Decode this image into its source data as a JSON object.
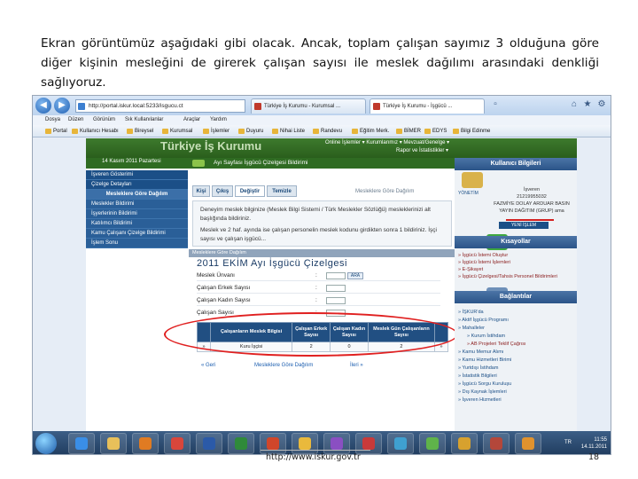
{
  "slide": {
    "intro_text": "Ekran görüntümüz aşağıdaki gibi olacak. Ancak, toplam çalışan sayımız 3 olduğuna göre diğer kişinin mesleğini de girerek çalışan sayısı ile meslek dağılımı arasındaki denkliği sağlıyoruz.",
    "footer_url": "http://www.iskur.gov.tr",
    "page_number": "18"
  },
  "browser": {
    "address": "http://portal.iskur.local:5233/isgucu.ct",
    "tabs": [
      "Türkiye İş Kurumu - Kurumsal ...",
      "Türkiye İş Kurumu - İşgücü ..."
    ],
    "menu": [
      "Dosya",
      "Düzen",
      "Görünüm",
      "Sık Kullanılanlar",
      "Araçlar",
      "Yardım"
    ],
    "favorites": [
      "Portal",
      "Kullanıcı Hesabı",
      "Bireysel",
      "Kurumsal",
      "İşlemler",
      "Duyuru",
      "Nihai Liste",
      "Randevu",
      "Eğitim Merk.",
      "BİMER",
      "EDYS",
      "Bilgi Edinme"
    ]
  },
  "site": {
    "logo": "Türkiye İş Kurumu",
    "top_menu_1": "Online İşlemler ▾   Kurumlarımız ▾   Mevzuat/Genelge ▾",
    "top_menu_2": "Rapor ve İstatistikler ▾",
    "date": "14 Kasım 2011 Pazartesi",
    "breadcrumb": "Ayı Sayfası İşgücü Çizelgesi Bildirimi"
  },
  "left_nav": {
    "items": [
      "İşveren Gösterimi",
      "Çizelge Detayları"
    ],
    "section_header": "Mesleklere Göre Dağılım",
    "section_items": [
      "Meslekler Bildirimi",
      "İşyerlerinin Bildirimi",
      "Katılımcı Bildirimi",
      "Kamu Çalışanı Çizelge Bildirimi",
      "İşlem Sonu"
    ]
  },
  "main": {
    "tabs": [
      "Kişi",
      "Çıkış",
      "Değiştir",
      "Temizle"
    ],
    "tab_right": "Mesleklere Göre Dağılım",
    "info_lines": [
      "Deneyim meslek bilginize (Meslek Bilgi Sistemi / Türk Meslekler Sözlüğü) mesleklerinizi alt başlığında bildiriniz.",
      "Meslek ve 2 haf. ayında ise çalışan personelin meslek kodunu girdikten sonra 1 bildiriniz. İşçi sayısı ve çalışan işgücü..."
    ],
    "grid_title": "Mesleklere Göre Dağılım",
    "form_title": "2011 EKİM Ayı İşgücü Çizelgesi",
    "form_rows": [
      {
        "label": "Meslek Ünvanı",
        "has_select": true,
        "select_text": "ARA"
      },
      {
        "label": "Çalışan Erkek Sayısı",
        "has_select": false,
        "select_text": ""
      },
      {
        "label": "Çalışan Kadın Sayısı",
        "has_select": false,
        "select_text": ""
      },
      {
        "label": "Çalışan Sayısı",
        "has_select": false,
        "select_text": ""
      }
    ],
    "table_headers": [
      "",
      "Çalışanların Meslek Bilgisi",
      "Çalışan Erkek Sayısı",
      "Çalışan Kadın Sayısı",
      "Meslek Gün Çalışanların Sayısı",
      ""
    ],
    "table_rows": [
      {
        "mark": "»",
        "meslek": "Kuru İşçisi",
        "erkek": "2",
        "kadin": "0",
        "toplam": "2",
        "act": "»"
      }
    ],
    "bottom_links": [
      "« Geri",
      "Mesleklere Göre Dağılım",
      "İleri »"
    ]
  },
  "right_panel": {
    "header_user": "Kullanıcı Bilgileri",
    "user_lines": [
      "İşveren",
      "21219955032",
      "FAZMİYE DOLAY ARDUAR BASIN",
      "YAYIN DAĞITIM (GRUP) ama"
    ],
    "user_button": "YENİ İŞLEM",
    "header_shortcuts": "Kısayollar",
    "shortcuts": [
      "» İşgücü İstemi Oluştur",
      "» İşgücü İstemi İşlemleri",
      "» E-Şikayet",
      "» İşgücü Çizelgesi/Tahsis Personel Bildirimleri"
    ],
    "header_links": "Bağlantılar",
    "links": [
      "» İŞKUR'da",
      "» Aktif İşgücü Programı",
      "» Mahalleler",
      "» Kurum İstihdam",
      "» AB Projeleri  Teklif Çağrısı",
      "» Kamu Memur Alımı",
      "» Kamu Hizmetleri Birimi",
      "» Yurtdışı İstihdam",
      "» İstatistik Bilgileri",
      "» İşgücü Sorgu Kuruluşu",
      "» Dış Kaynak İşlemleri",
      "» İşveren Hizmetleri"
    ],
    "stamp_label": "YÖNETİM"
  },
  "taskbar": {
    "language": "TR",
    "time": "11:55",
    "date": "14.11.2011"
  },
  "colors": {
    "site_green": "#2f6b22",
    "nav_blue": "#1b4f87",
    "highlight_red": "#e02020"
  }
}
